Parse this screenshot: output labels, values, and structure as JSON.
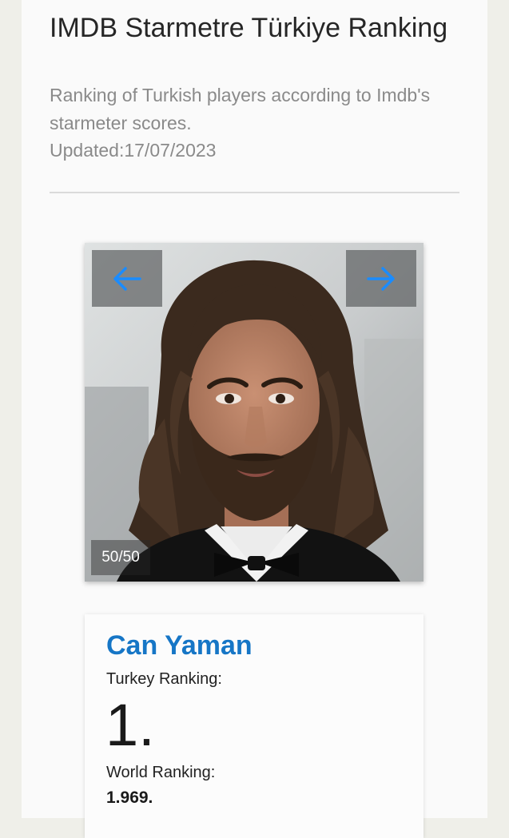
{
  "header": {
    "title": "IMDB Starmetre Türkiye Ranking",
    "subtitle": "Ranking of Turkish players according to Imdb's starmeter scores.",
    "updated": "Updated:17/07/2023"
  },
  "slider": {
    "counter": "50/50",
    "prev_icon": "arrow-left-icon",
    "next_icon": "arrow-right-icon",
    "accent_color": "#1a8cff"
  },
  "actor": {
    "name": "Can Yaman",
    "turkey_label": "Turkey Ranking:",
    "turkey_rank": "1.",
    "world_label": "World Ranking:",
    "world_rank": "1.969.",
    "name_color": "#1676c6"
  }
}
